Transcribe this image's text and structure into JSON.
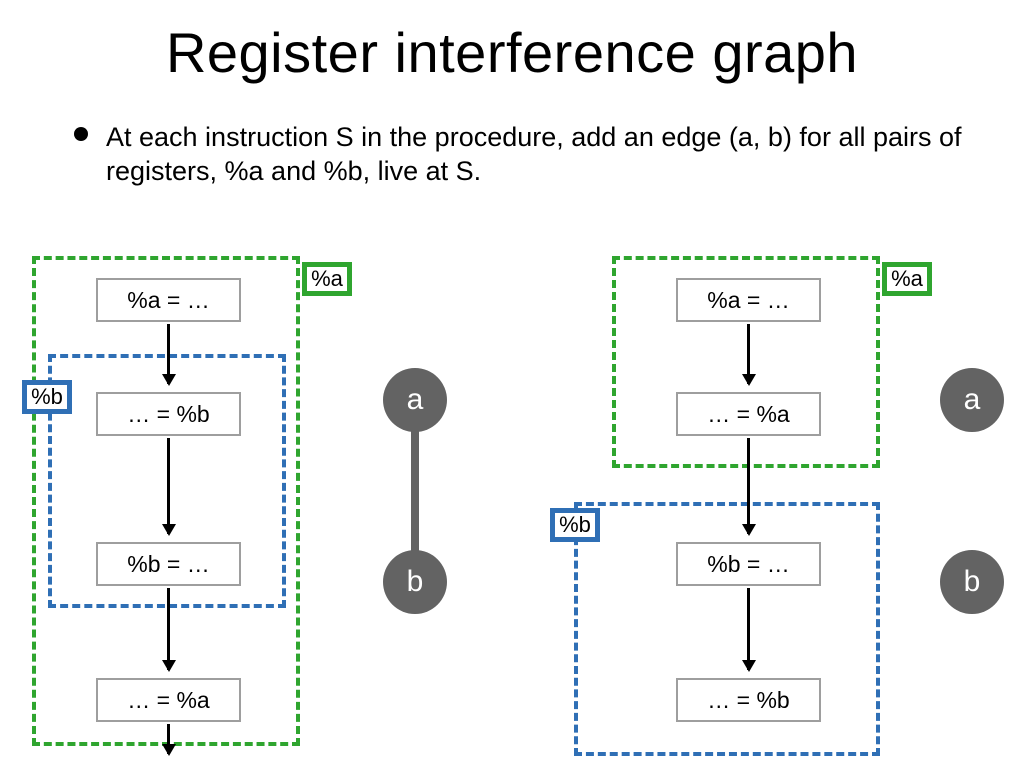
{
  "title": "Register interference graph",
  "bullet": "At each instruction S in the procedure, add an edge (a, b) for all pairs of registers, %a and %b, live at S.",
  "left": {
    "tag_a": "%a",
    "tag_b": "%b",
    "instr1": "%a = …",
    "instr2": "… = %b",
    "instr3": "%b = …",
    "instr4": "… = %a"
  },
  "right": {
    "tag_a": "%a",
    "tag_b": "%b",
    "instr1": "%a = …",
    "instr2": "… = %a",
    "instr3": "%b = …",
    "instr4": "… = %b"
  },
  "graph": {
    "node_a": "a",
    "node_b": "b"
  }
}
